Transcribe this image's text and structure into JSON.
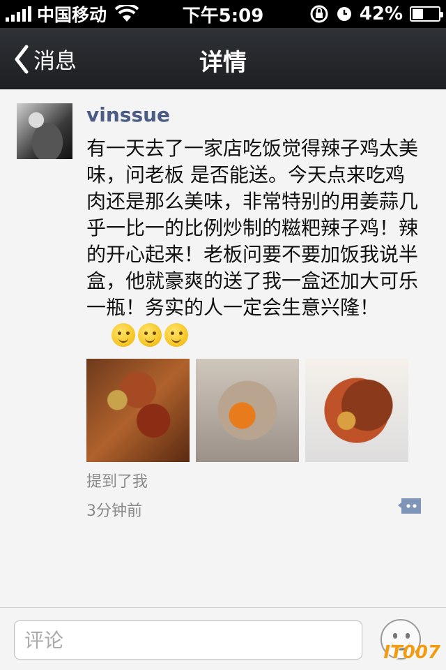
{
  "status_bar": {
    "carrier": "中国移动",
    "time": "下午5:09",
    "battery_percent": "42%",
    "battery_level": 0.42
  },
  "nav": {
    "back_label": "消息",
    "title": "详情"
  },
  "post": {
    "username": "vinssue",
    "text": "有一天去了一家店吃饭觉得辣子鸡太美味，问老板 是否能送。今天点来吃鸡肉还是那么美味，非常特别的用姜蒜几乎一比一的比例炒制的糍粑辣子鸡！辣的开心起来！老板问要不要加饭我说半盒，他就豪爽的送了我一盒还加大可乐一瓶！务实的人一定会生意兴隆！",
    "emoji_count": 3,
    "mentions": "提到了我",
    "time": "3分钟前"
  },
  "comment_bar": {
    "placeholder": "评论"
  },
  "watermark": "IT007"
}
